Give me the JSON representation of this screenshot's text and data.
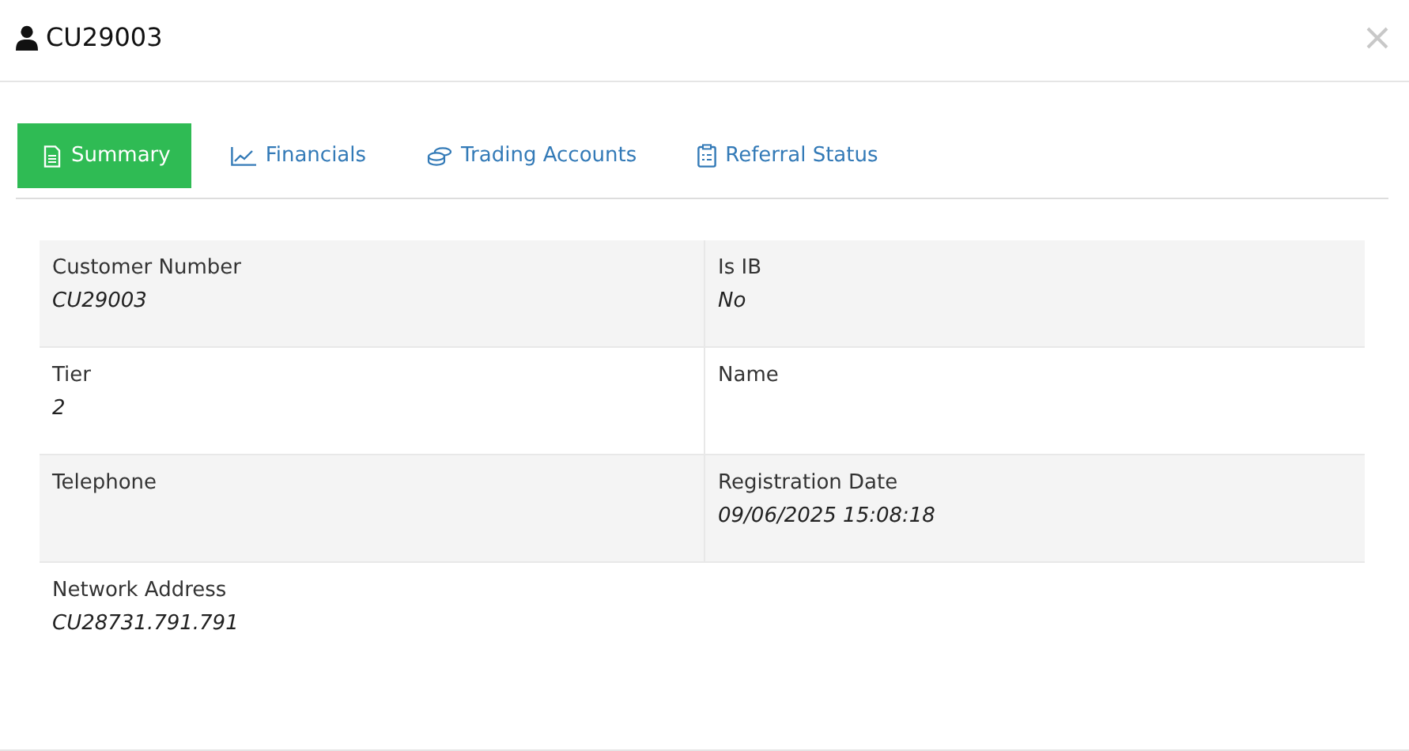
{
  "dialog": {
    "title": "CU29003"
  },
  "tabs": [
    {
      "label": "Summary",
      "kind": "document",
      "selected": true
    },
    {
      "label": "Financials",
      "kind": "chart",
      "selected": false
    },
    {
      "label": "Trading Accounts",
      "kind": "coins",
      "selected": false
    },
    {
      "label": "Referral Status",
      "kind": "clipboard",
      "selected": false
    }
  ],
  "rows": [
    [
      {
        "label": "Customer Number",
        "value": "CU29003"
      },
      {
        "label": "Is IB",
        "value": "No"
      }
    ],
    [
      {
        "label": "Tier",
        "value": "2"
      },
      {
        "label": "Name"
      }
    ],
    [
      {
        "label": "Telephone"
      },
      {
        "label": "Registration Date",
        "value": "09/06/2025 15:08:18"
      }
    ],
    [
      {
        "label": "Network Address",
        "value": "CU28731.791.791"
      }
    ]
  ]
}
